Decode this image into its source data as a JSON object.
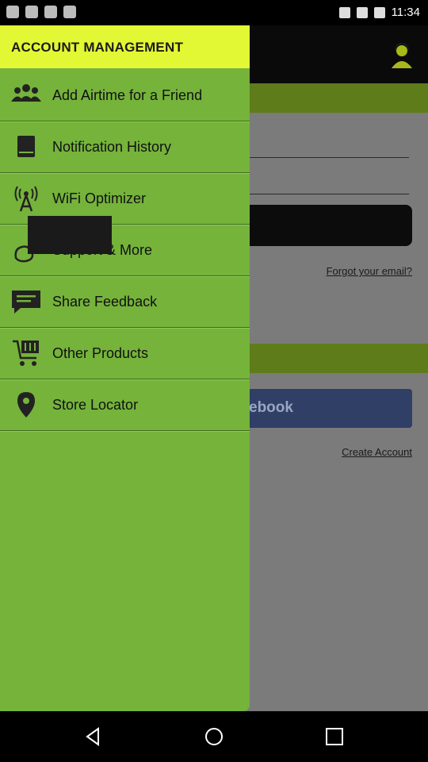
{
  "status_bar": {
    "time": "11:34"
  },
  "drawer": {
    "title": "ACCOUNT MANAGEMENT",
    "items": [
      {
        "label": "Add Airtime for a Friend",
        "icon": "people-icon"
      },
      {
        "label": "Notification History",
        "icon": "book-icon"
      },
      {
        "label": "WiFi Optimizer",
        "icon": "antenna-icon"
      },
      {
        "label": "Support & More",
        "icon": "support-icon"
      },
      {
        "label": "Share Feedback",
        "icon": "chat-icon"
      },
      {
        "label": "Other Products",
        "icon": "cart-icon"
      },
      {
        "label": "Store Locator",
        "icon": "location-pin-icon"
      }
    ]
  },
  "background": {
    "forgot_link": "Forgot your email?",
    "facebook_button": "ebook",
    "create_account_link": "Create Account"
  },
  "colors": {
    "drawer_bg": "#75b33b",
    "drawer_header_bg": "#e3f835",
    "accent_band": "#5e7c19"
  }
}
